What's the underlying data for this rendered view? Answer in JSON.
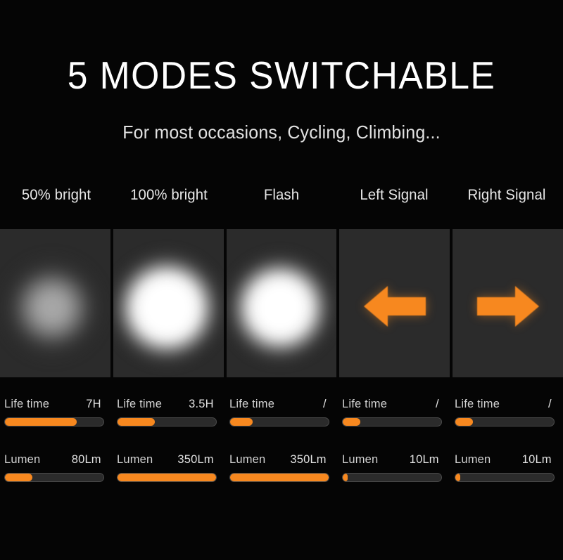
{
  "hero": {
    "title": "5 MODES SWITCHABLE",
    "subtitle": "For most occasions, Cycling, Climbing..."
  },
  "colors": {
    "background": "#050505",
    "panel": "#2b2b2b",
    "accent_orange": "#f7881f",
    "bar_track": "#2b2b2b",
    "bar_border": "#4a4a4a",
    "text_primary": "#ffffff",
    "text_secondary": "#d7d7d7"
  },
  "modes": [
    {
      "label": "50% bright",
      "visual": "beam-glow-dim",
      "icon": "light-beam-icon",
      "life_time": {
        "key": "Life time",
        "value": "7H",
        "percent": 73
      },
      "lumen": {
        "key": "Lumen",
        "value": "80Lm",
        "percent": 28
      }
    },
    {
      "label": "100% bright",
      "visual": "beam-glow-bright",
      "icon": "light-beam-icon",
      "life_time": {
        "key": "Life time",
        "value": "3.5H",
        "percent": 38
      },
      "lumen": {
        "key": "Lumen",
        "value": "350Lm",
        "percent": 100
      }
    },
    {
      "label": "Flash",
      "visual": "beam-glow-flash",
      "icon": "light-beam-icon",
      "life_time": {
        "key": "Life time",
        "value": "/",
        "percent": 23
      },
      "lumen": {
        "key": "Lumen",
        "value": "350Lm",
        "percent": 100
      }
    },
    {
      "label": "Left Signal",
      "visual": "arrow-left",
      "icon": "arrow-left-icon",
      "life_time": {
        "key": "Life time",
        "value": "/",
        "percent": 18
      },
      "lumen": {
        "key": "Lumen",
        "value": "10Lm",
        "percent": 5
      }
    },
    {
      "label": "Right Signal",
      "visual": "arrow-right",
      "icon": "arrow-right-icon",
      "life_time": {
        "key": "Life time",
        "value": "/",
        "percent": 18
      },
      "lumen": {
        "key": "Lumen",
        "value": "10Lm",
        "percent": 5
      }
    }
  ]
}
